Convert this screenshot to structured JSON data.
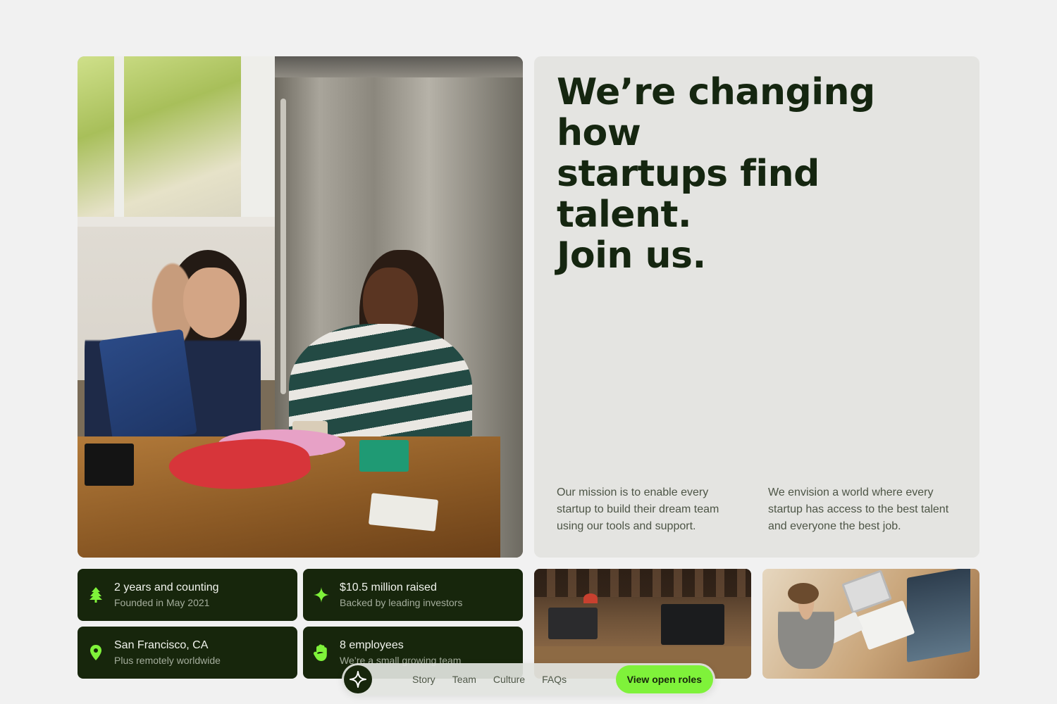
{
  "headline": {
    "lines": [
      "We’re changing how",
      "startups find talent.",
      "Join us."
    ]
  },
  "mission_text": "Our mission is to enable every startup to build their dream team using our tools and support.",
  "vision_text": "We envision a world where every startup has access to the best talent and everyone the best job.",
  "stats": [
    {
      "icon": "tree-icon",
      "title": "2 years and counting",
      "subtitle": "Founded in May 2021"
    },
    {
      "icon": "sparkle-icon",
      "title": "$10.5 million raised",
      "subtitle": "Backed by leading investors"
    },
    {
      "icon": "location-pin-icon",
      "title": "San Francisco, CA",
      "subtitle": "Plus remotely worldwide"
    },
    {
      "icon": "hand-wave-icon",
      "title": "8 employees",
      "subtitle": "We’re a small growing team"
    }
  ],
  "nav": {
    "links": [
      "Story",
      "Team",
      "Culture",
      "FAQs"
    ],
    "cta_label": "View open roles"
  },
  "colors": {
    "accent": "#7ff23a",
    "dark_green": "#17260c",
    "panel_bg": "#e4e4e1",
    "page_bg": "#f1f1f1"
  }
}
